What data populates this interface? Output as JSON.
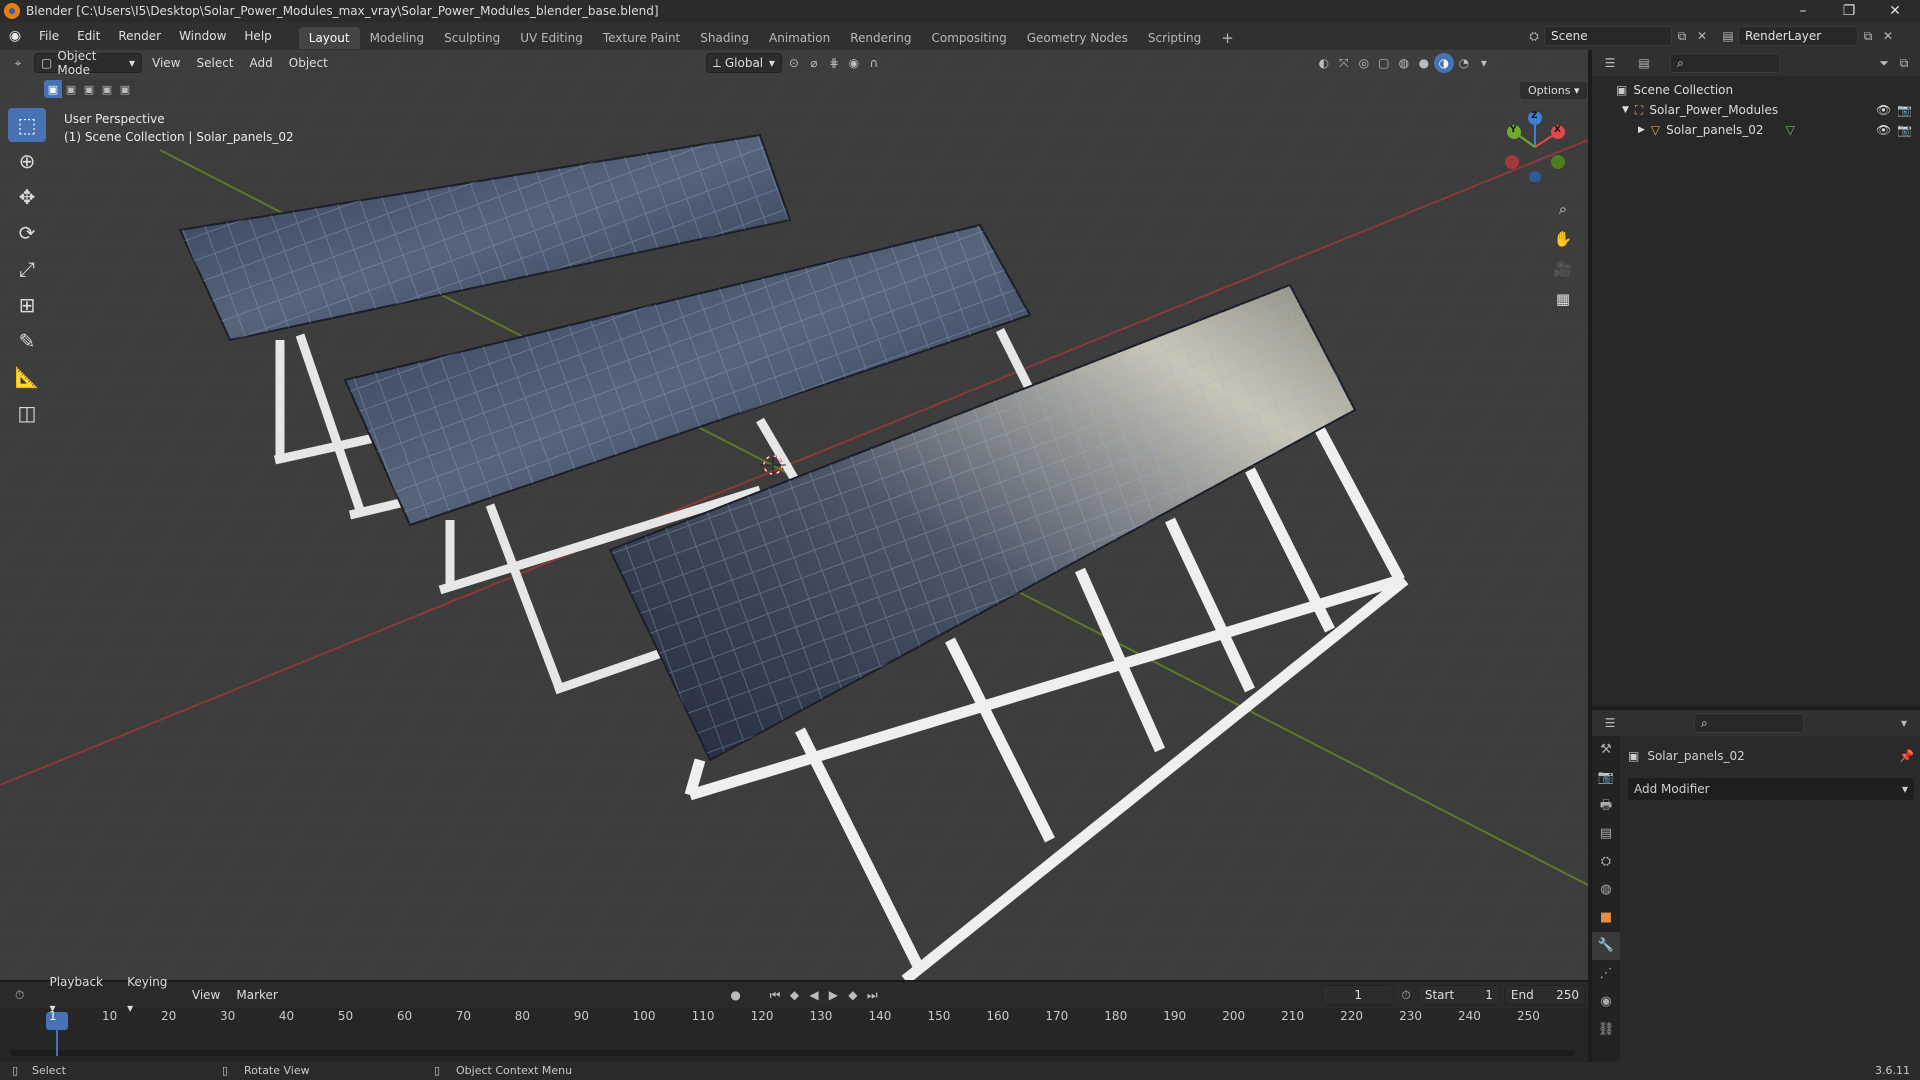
{
  "window": {
    "title": "Blender [C:\\Users\\I5\\Desktop\\Solar_Power_Modules_max_vray\\Solar_Power_Modules_blender_base.blend]",
    "minimize": "–",
    "maximize": "❐",
    "close": "✕"
  },
  "menu": {
    "items": [
      "File",
      "Edit",
      "Render",
      "Window",
      "Help"
    ]
  },
  "workspaces": {
    "tabs": [
      "Layout",
      "Modeling",
      "Sculpting",
      "UV Editing",
      "Texture Paint",
      "Shading",
      "Animation",
      "Rendering",
      "Compositing",
      "Geometry Nodes",
      "Scripting"
    ],
    "add": "+",
    "active": "Layout"
  },
  "scene": {
    "name": "Scene",
    "view_layer": "RenderLayer"
  },
  "viewport": {
    "mode": "Object Mode",
    "menus": [
      "View",
      "Select",
      "Add",
      "Object"
    ],
    "orientation": "Global",
    "options": "Options",
    "perspective_label": "User Perspective",
    "collection_label": "(1) Scene Collection | Solar_panels_02",
    "gizmo": {
      "x": "X",
      "y": "Y",
      "z": "Z"
    }
  },
  "outliner": {
    "root": "Scene Collection",
    "collection": "Solar_Power_Modules",
    "object": "Solar_panels_02"
  },
  "properties": {
    "object_name": "Solar_panels_02",
    "add_modifier": "Add Modifier"
  },
  "timeline": {
    "menus": [
      "Playback",
      "Keying",
      "View",
      "Marker"
    ],
    "current_frame": "1",
    "start_label": "Start",
    "start": "1",
    "end_label": "End",
    "end": "250",
    "ticks": [
      "1",
      "10",
      "20",
      "30",
      "40",
      "50",
      "60",
      "70",
      "80",
      "90",
      "100",
      "110",
      "120",
      "130",
      "140",
      "150",
      "160",
      "170",
      "180",
      "190",
      "200",
      "210",
      "220",
      "230",
      "240",
      "250"
    ]
  },
  "status": {
    "select": "Select",
    "rotate": "Rotate View",
    "context": "Object Context Menu",
    "version": "3.6.11"
  },
  "colors": {
    "accent": "#4772b3",
    "x_axis": "#e0484a",
    "y_axis": "#6faa2e",
    "z_axis": "#3f7dd6",
    "background": "#3d3d3d"
  }
}
